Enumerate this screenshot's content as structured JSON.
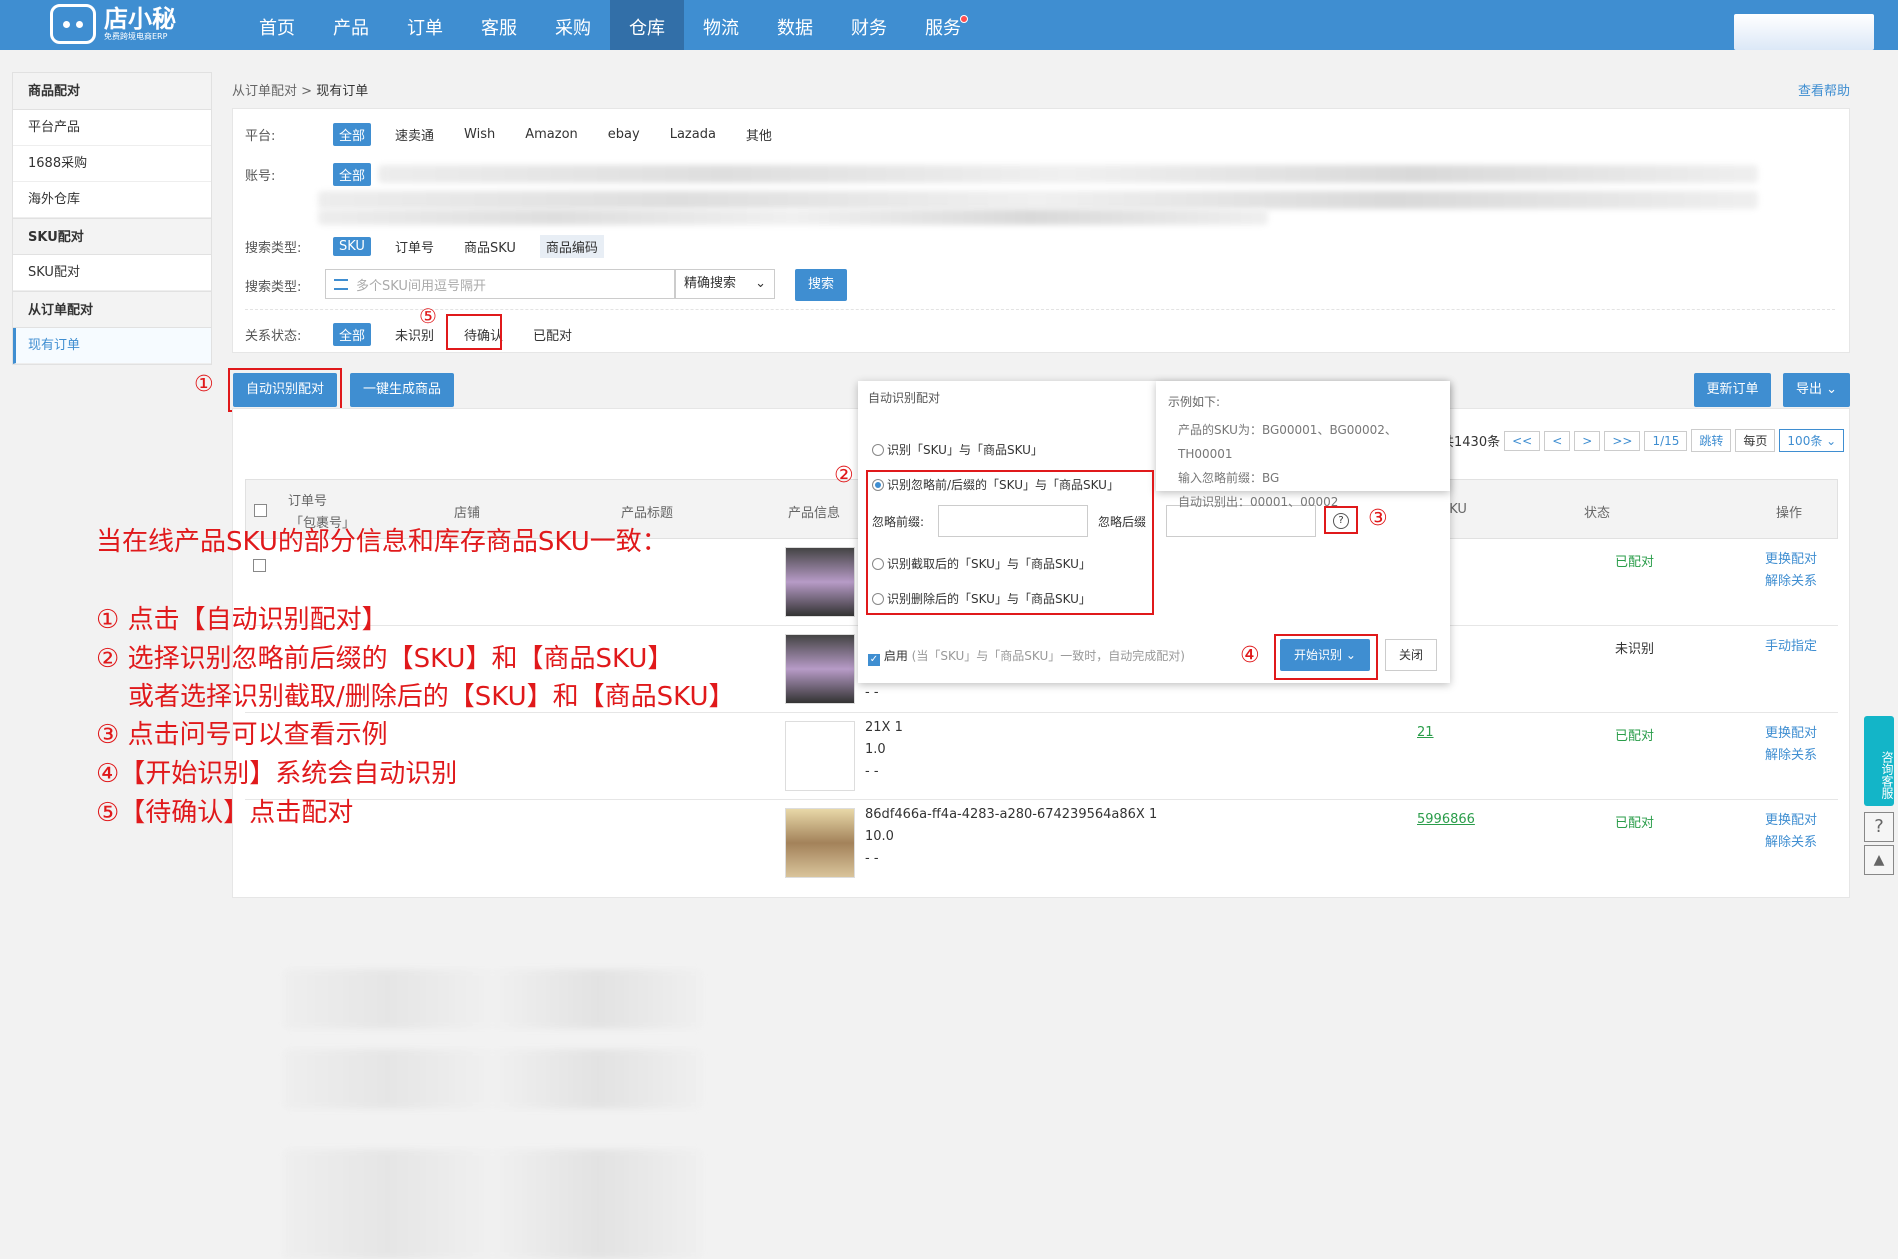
{
  "logo": {
    "name": "店小秘",
    "sub": "免费跨境电商ERP"
  },
  "nav": [
    "首页",
    "产品",
    "订单",
    "客服",
    "采购",
    "仓库",
    "物流",
    "数据",
    "财务",
    "服务"
  ],
  "sidebar": {
    "sections": [
      {
        "title": "商品配对",
        "items": [
          "平台产品",
          "1688采购",
          "海外仓库"
        ]
      },
      {
        "title": "SKU配对",
        "items": [
          "SKU配对"
        ]
      },
      {
        "title": "从订单配对",
        "items": [
          "现有订单"
        ]
      }
    ]
  },
  "breadcrumb": {
    "parent": "从订单配对",
    "sep": " > ",
    "current": "现有订单"
  },
  "help": "查看帮助",
  "filters": {
    "platform_label": "平台:",
    "platforms": [
      "全部",
      "速卖通",
      "Wish",
      "Amazon",
      "ebay",
      "Lazada",
      "其他"
    ],
    "account_label": "账号:",
    "account_all": "全部",
    "search_type_label": "搜索类型:",
    "search_types": [
      "SKU",
      "订单号",
      "商品SKU",
      "商品编码"
    ],
    "search_label": "搜索类型:",
    "search_placeholder": "多个SKU间用逗号隔开",
    "match_mode": "精确搜索",
    "search_btn": "搜索",
    "status_label": "关系状态:",
    "statuses": [
      "全部",
      "未识别",
      "待确认",
      "已配对"
    ]
  },
  "actions": {
    "auto_match": "自动识别配对",
    "gen_products": "一键生成商品",
    "update": "更新订单",
    "export": "导出"
  },
  "pager": {
    "total": "，共1430条",
    "first": "<<",
    "prev": "<",
    "next": ">",
    "last": ">>",
    "page": "1/15",
    "jump": "跳转",
    "per_label": "每页",
    "per": "100条"
  },
  "table": {
    "headers": {
      "order": "订单号",
      "package": "「包裹号」",
      "shop": "店铺",
      "title": "产品标题",
      "info": "产品信息",
      "sku": "SKU",
      "status": "状态",
      "ops": "操作"
    },
    "rows": [
      {
        "info": [
          "",
          "",
          ""
        ],
        "sku": "",
        "status": "已配对",
        "ops": [
          "更换配对",
          "解除关系"
        ]
      },
      {
        "info": [
          "",
          "",
          "- -"
        ],
        "sku": "",
        "status": "未识别",
        "ops": [
          "手动指定"
        ]
      },
      {
        "info": [
          "21X 1",
          "1.0",
          "- -"
        ],
        "sku": "21",
        "status": "已配对",
        "ops": [
          "更换配对",
          "解除关系"
        ]
      },
      {
        "info": [
          "86df466a-ff4a-4283-a280-674239564a86X 1",
          "10.0",
          "- -"
        ],
        "sku": "5996866",
        "status": "已配对",
        "ops": [
          "更换配对",
          "解除关系"
        ]
      }
    ]
  },
  "popup": {
    "title": "自动识别配对",
    "opt1": "识别「SKU」与「商品SKU」",
    "opt2": "识别忽略前/后缀的「SKU」与「商品SKU」",
    "prefix_label": "忽略前缀:",
    "suffix_label": "忽略后缀",
    "opt3": "识别截取后的「SKU」与「商品SKU」",
    "opt4": "识别删除后的「SKU」与「商品SKU」",
    "enable": "启用",
    "enable_note": "(当「SKU」与「商品SKU」一致时，自动完成配对)",
    "start": "开始识别",
    "close": "关闭",
    "help_q": "?"
  },
  "example": {
    "title": "示例如下:",
    "l1": "产品的SKU为：BG00001、BG00002、TH00001",
    "l2": "输入忽略前缀：BG",
    "l3": "自动识别出：00001、00002"
  },
  "markers": {
    "m1": "①",
    "m2": "②",
    "m3": "③",
    "m4": "④",
    "m5": "⑤"
  },
  "instructions": {
    "heading": "当在线产品SKU的部分信息和库存商品SKU一致：",
    "s1": "① 点击【自动识别配对】",
    "s2": "② 选择识别忽略前后缀的【SKU】和【商品SKU】",
    "s2b": "或者选择识别截取/删除后的【SKU】和【商品SKU】",
    "s3": "③ 点击问号可以查看示例",
    "s4": "④【开始识别】系统会自动识别",
    "s5": "⑤【待确认】点击配对"
  },
  "service": "咨询客服"
}
